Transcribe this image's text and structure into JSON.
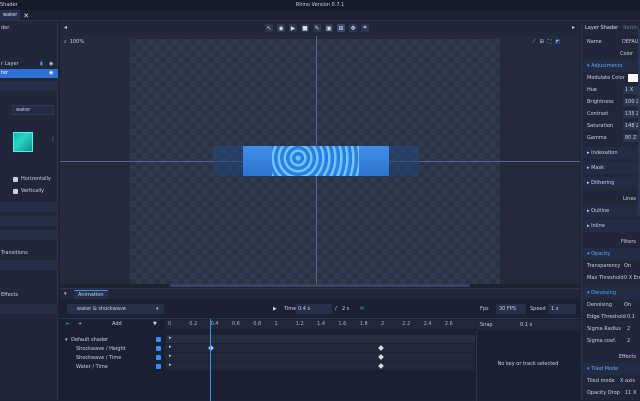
{
  "window": {
    "menu_fragment": "Shader",
    "title": "Rhino Version 0.7.1"
  },
  "document_tab": {
    "label": "water"
  },
  "left_panel": {
    "header_fragment": "der",
    "layer_fragment": "r Layer",
    "selected_layer": "ter",
    "name_value": "water",
    "flip_horizontal": "Horizontally",
    "flip_vertical": "Vertically",
    "transitions_label": "Transitions",
    "effects_label": "Effects"
  },
  "viewport": {
    "zoom_label": "100%"
  },
  "animation": {
    "tab_label": "Animation",
    "clip_name": "water & shockwave",
    "time_label": "Time",
    "time_value": "0.4 s",
    "duration_value": "2 s",
    "fps_label": "Fps",
    "fps_value": "30 FPS",
    "speed_label": "Speed",
    "speed_value": "1 x",
    "add_label": "Add",
    "snap_label": "Snap",
    "snap_value": "0.1 s",
    "ruler": [
      "0",
      "0.2",
      "0.4",
      "0.6",
      "0.8",
      "1",
      "1.2",
      "1.4",
      "1.6",
      "1.8",
      "2",
      "2.2",
      "2.4",
      "2.6"
    ],
    "group_label": "Default shader",
    "tracks": [
      "Shockwave / Height",
      "Shockwave / Time",
      "Water / Time"
    ],
    "empty_state": "No key or track selected"
  },
  "right_panel": {
    "tab_active": "Layer Shader",
    "tab_other": "Settin",
    "name_label": "Name",
    "name_value": "DEFAU",
    "color_label": "Color",
    "adjustments_label": "Adjustments",
    "modulate_label": "Modulate Color",
    "hue_label": "Hue",
    "hue_value": "1 X",
    "brightness_label": "Brightness",
    "brightness_value": "100 Z",
    "contrast_label": "Contrast",
    "contrast_value": "135 Z",
    "saturation_label": "Saturation",
    "saturation_value": "148 Z",
    "gamma_label": "Gamma",
    "gamma_value": "80 Z",
    "indexation_label": "Indexation",
    "mask_label": "Mask",
    "dithering_label": "Dithering",
    "lines_label": "Lines",
    "outline_label": "Outline",
    "inline_label": "Inline",
    "filters_label": "Filters",
    "opacity_label": "Opacity",
    "transparency_label": "Transparency",
    "transparency_value": "On",
    "max_threshold_label": "Max Threshold",
    "max_threshold_value": "0 X En",
    "denoising_section": "Denoising",
    "denoising_label": "Denoising",
    "denoising_value": "On",
    "edge_label": "Edge Threshold",
    "edge_value": "0.1",
    "sigma_radius_label": "Sigma Radius",
    "sigma_radius_value": "2",
    "sigma_coef_label": "Sigma coef.",
    "sigma_coef_value": "2",
    "effects_label": "Effects",
    "tiled_section": "Tiled Mode",
    "tiled_label": "Tiled mode",
    "tiled_value": "X axis",
    "opacity_drop_label": "Opacity Drop",
    "opacity_drop_value": "11 X",
    "accent_color": "#3a8cff"
  }
}
